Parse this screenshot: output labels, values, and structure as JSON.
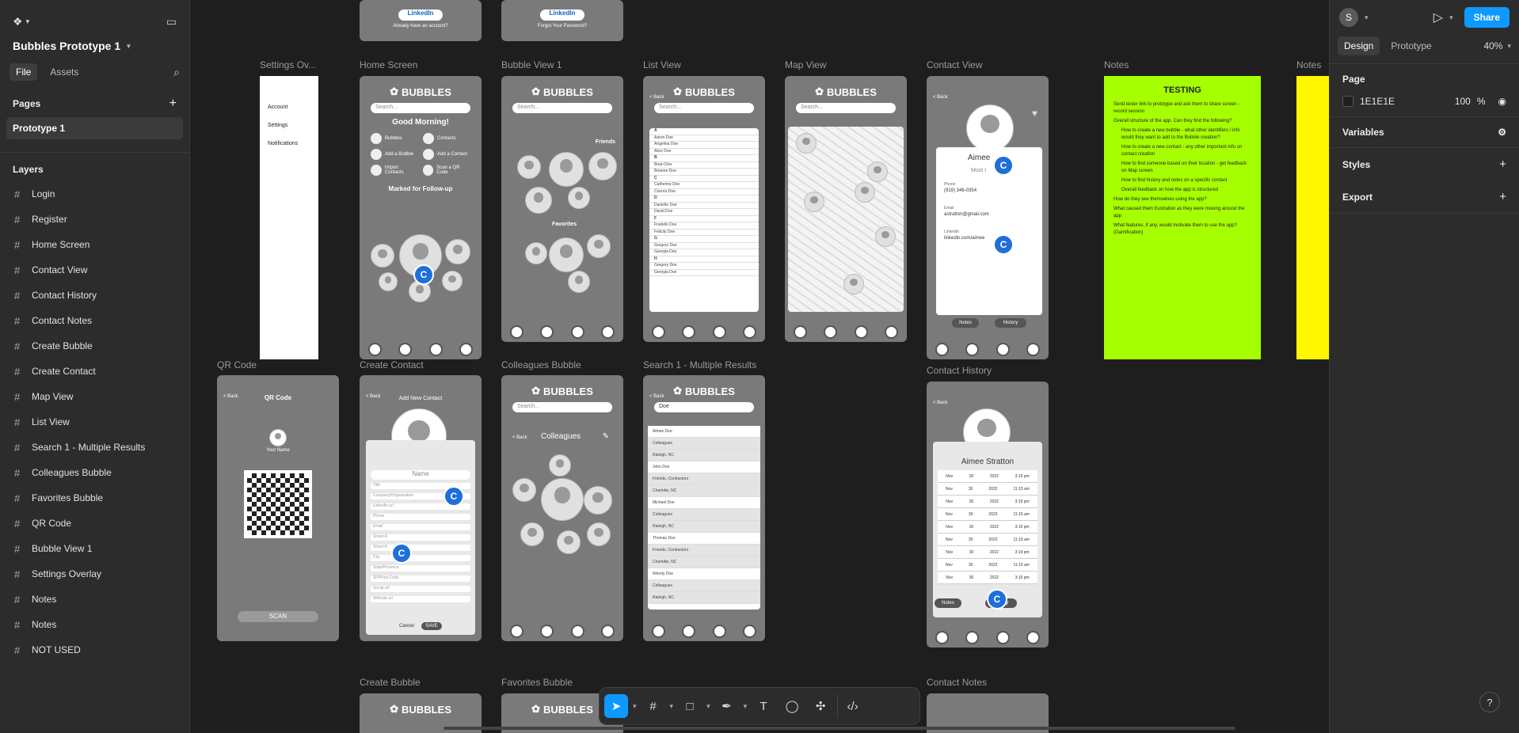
{
  "project": {
    "name": "Bubbles Prototype 1"
  },
  "left_tabs": {
    "file": "File",
    "assets": "Assets"
  },
  "pages": {
    "header": "Pages",
    "items": [
      "Prototype 1"
    ]
  },
  "layers": {
    "header": "Layers",
    "items": [
      "Login",
      "Register",
      "Home Screen",
      "Contact View",
      "Contact History",
      "Contact Notes",
      "Create Bubble",
      "Create Contact",
      "Map View",
      "List View",
      "Search 1 - Multiple Results",
      "Colleagues Bubble",
      "Favorites Bubble",
      "QR Code",
      "Bubble View 1",
      "Settings Overlay",
      "Notes",
      "Notes",
      "NOT USED"
    ]
  },
  "right_panel": {
    "avatar": "S",
    "share": "Share",
    "tab_design": "Design",
    "tab_prototype": "Prototype",
    "zoom": "40%",
    "page_header": "Page",
    "page_color": "1E1E1E",
    "page_opacity": "100",
    "percent": "%",
    "variables": "Variables",
    "styles": "Styles",
    "export": "Export"
  },
  "frames": {
    "settings_overlay": {
      "label": "Settings Ov...",
      "items": [
        "Account",
        "Settings",
        "Notifications"
      ]
    },
    "home": {
      "label": "Home Screen",
      "greeting": "Good Morning!",
      "section": "Marked for Follow-up",
      "actions": [
        "Bubbles",
        "Contacts",
        "Add a Bubble",
        "Add a Contact",
        "Import Contacts",
        "Scan a QR Code"
      ]
    },
    "bubble_view": {
      "label": "Bubble View 1",
      "friends": "Friends",
      "favorites": "Favorites"
    },
    "list_view": {
      "label": "List View",
      "back": "< Back",
      "letters": [
        "A",
        "B",
        "C",
        "D",
        "F",
        "G",
        "H"
      ],
      "names": [
        "Aaron Doe",
        "Angelina Doe",
        "Alice Doe",
        "Brian Doe",
        "Brianne Doe",
        "Catherine Doe",
        "Connor Doe",
        "Danielle Doe",
        "David Doe",
        "Franklin Doe",
        "Felicity Doe",
        "Gregory Doe",
        "Georgia Doe",
        "Gregory Doe",
        "Georgia Doe"
      ]
    },
    "map_view": {
      "label": "Map View"
    },
    "contact_view": {
      "label": "Contact View",
      "name": "Aimee",
      "most": "Most I",
      "phone_label": "Phone",
      "phone": "(919) 346-0354",
      "email_label": "Email",
      "email": "astratton@gmail.com",
      "linkedin_label": "LinkedIn",
      "linkedin": "linkedin.com/aimee",
      "notes": "Notes",
      "history": "History"
    },
    "notes1": {
      "label": "Notes",
      "title": "TESTING",
      "lines": [
        "Send tester link to prototype and ask them to share screen - record session",
        "Overall structure of the app. Can they find the following?",
        "How to create a new bubble - what other identifiers / info would they want to add to the Bubble creation?",
        "How to create a new contact - any other important info on contact creation",
        "How to find someone based on their location - get feedback on Map screen",
        "How to find history and notes on a specific contact",
        "Overall feedback on how the app is structured",
        "How do they see themselves using the app?",
        "What caused them frustration as they were moving around the app",
        "What features, if any, would motivate them to use the app? (Gamification)"
      ]
    },
    "notes2": {
      "label": "Notes"
    },
    "qr": {
      "label": "QR Code",
      "back": "< Back",
      "title": "QR Code",
      "name": "Your Name",
      "scan": "SCAN"
    },
    "create_contact": {
      "label": "Create Contact",
      "back": "< Back",
      "title": "Add New Contact",
      "name": "Name",
      "fields": [
        "Title",
        "Company/Organization",
        "LinkedIn url",
        "Phone",
        "Email",
        "Street A",
        "Street A",
        "City",
        "State/Province",
        "ZIP/Post Code",
        "Social url",
        "Website url"
      ],
      "country": "Country",
      "cancel": "Cancel",
      "save": "SAVE"
    },
    "colleagues": {
      "label": "Colleagues Bubble",
      "back": "< Back",
      "title": "Colleagues"
    },
    "search": {
      "label": "Search 1 - Multiple Results",
      "back": "< Back",
      "query": "Doe",
      "rows": [
        "Aimee Doe",
        "Colleagues",
        "Raleigh, NC",
        "John Doe",
        "Friends, Contractors",
        "Charlotte, NC",
        "Michael Doe",
        "Colleagues",
        "Raleigh, NC",
        "Thomas Doe",
        "Friends, Contractors",
        "Charlotte, NC",
        "Wendy Doe",
        "Colleagues",
        "Raleigh, NC"
      ]
    },
    "contact_history": {
      "label": "Contact History",
      "back": "< Back",
      "name": "Aimee Stratton",
      "notes": "Notes",
      "history": "History",
      "rows": [
        [
          "Nov",
          "30",
          "2022",
          "3:19 pm"
        ],
        [
          "Nov",
          "30",
          "2022",
          "11:15 am"
        ],
        [
          "Nov",
          "30",
          "2022",
          "3:19 pm"
        ],
        [
          "Nov",
          "30",
          "2022",
          "11:15 am"
        ],
        [
          "Nov",
          "30",
          "2022",
          "3:19 pm"
        ],
        [
          "Nov",
          "30",
          "2022",
          "11:15 am"
        ],
        [
          "Nov",
          "30",
          "2022",
          "3:19 pm"
        ],
        [
          "Nov",
          "30",
          "2022",
          "11:15 am"
        ],
        [
          "Nov",
          "30",
          "2022",
          "3:19 pm"
        ]
      ]
    },
    "create_bubble": {
      "label": "Create Bubble"
    },
    "favorites_bubble": {
      "label": "Favorites Bubble"
    },
    "contact_notes": {
      "label": "Contact Notes"
    },
    "top_a": {
      "linkedin": "LinkedIn",
      "sub": "Already have an account?"
    },
    "top_b": {
      "linkedin": "LinkedIn",
      "sub": "Forgot Your Password?"
    }
  },
  "brand": "BUBBLES",
  "search_placeholder": "Search...",
  "cursor_letter": "C",
  "help": "?"
}
